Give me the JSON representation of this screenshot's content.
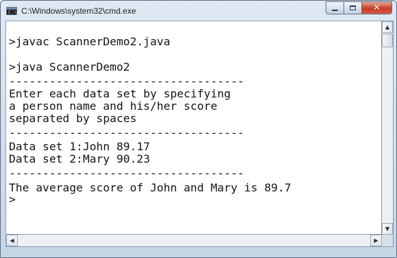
{
  "window": {
    "title": "C:\\Windows\\system32\\cmd.exe",
    "icon": "cmd-icon",
    "icon_glyph": "C:\\"
  },
  "caption_buttons": {
    "minimize_icon": "minimize-icon",
    "maximize_icon": "maximize-icon",
    "close_icon": "close-icon",
    "close_glyph": "✕"
  },
  "console": {
    "lines": [
      ">javac ScannerDemo2.java",
      ">java ScannerDemo2",
      "-----------------------------------",
      "Enter each data set by specifying",
      "a person name and his/her score",
      "separated by spaces",
      "-----------------------------------",
      "Data set 1:John 89.17",
      "Data set 2:Mary 90.23",
      "-----------------------------------",
      "The average score of John and Mary is 89.7",
      ">"
    ]
  },
  "scrollbars": {
    "up_arrow": "▲",
    "down_arrow": "▼",
    "left_arrow": "◀",
    "right_arrow": "▶"
  }
}
